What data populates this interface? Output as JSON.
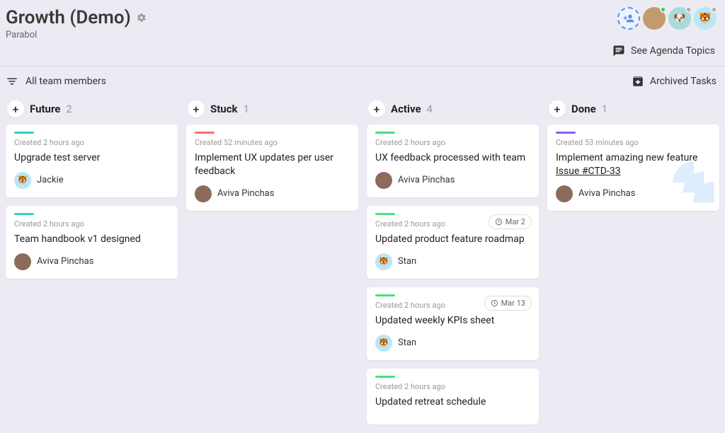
{
  "header": {
    "title": "Growth (Demo)",
    "subtitle": "Parabol",
    "agenda_label": "See Agenda Topics"
  },
  "toolbar": {
    "filter_label": "All team members",
    "archived_label": "Archived Tasks"
  },
  "columns": [
    {
      "title": "Future",
      "count": "2",
      "stripe": "stripe-future",
      "cards": [
        {
          "meta": "Created 2 hours ago",
          "title": "Upgrade test server",
          "assignee": "Jackie",
          "avatar": "emoji"
        },
        {
          "meta": "Created 2 hours ago",
          "title": "Team handbook v1 designed",
          "assignee": "Aviva Pinchas",
          "avatar": "photo"
        }
      ]
    },
    {
      "title": "Stuck",
      "count": "1",
      "stripe": "stripe-stuck",
      "cards": [
        {
          "meta": "Created 52 minutes ago",
          "title": "Implement UX updates per user feedback",
          "assignee": "Aviva Pinchas",
          "avatar": "photo"
        }
      ]
    },
    {
      "title": "Active",
      "count": "4",
      "stripe": "stripe-active",
      "cards": [
        {
          "meta": "Created 2 hours ago",
          "title": "UX feedback processed with team",
          "assignee": "Aviva Pinchas",
          "avatar": "photo"
        },
        {
          "meta": "Created 2 hours ago",
          "title": "Updated product feature roadmap",
          "assignee": "Stan",
          "avatar": "emoji",
          "due": "Mar 2"
        },
        {
          "meta": "Created 2 hours ago",
          "title": "Updated weekly KPIs sheet",
          "assignee": "Stan",
          "avatar": "emoji",
          "due": "Mar 13"
        },
        {
          "meta": "Created 2 hours ago",
          "title": "Updated retreat schedule",
          "assignee": "",
          "avatar": ""
        }
      ]
    },
    {
      "title": "Done",
      "count": "1",
      "stripe": "stripe-done",
      "cards": [
        {
          "meta": "Created 53 minutes ago",
          "title": "Implement amazing new feature",
          "issue": "Issue #CTD-33",
          "assignee": "Aviva Pinchas",
          "avatar": "photo",
          "jira": true
        }
      ]
    }
  ]
}
